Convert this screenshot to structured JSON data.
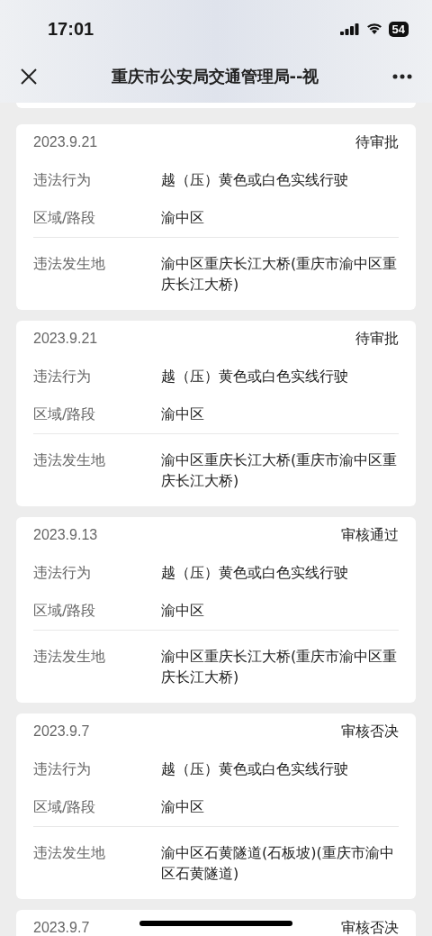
{
  "status_bar": {
    "time": "17:01",
    "battery": "54"
  },
  "nav_bar": {
    "title": "重庆市公安局交通管理局--视"
  },
  "records": [
    {
      "date": "2023.9.21",
      "status": "待审批",
      "rows": [
        {
          "label": "违法行为",
          "value": "越（压）黄色或白色实线行驶"
        },
        {
          "label": "区域/路段",
          "value": "渝中区"
        },
        {
          "label": "违法发生地",
          "value": "渝中区重庆长江大桥(重庆市渝中区重庆长江大桥)"
        }
      ]
    },
    {
      "date": "2023.9.21",
      "status": "待审批",
      "rows": [
        {
          "label": "违法行为",
          "value": "越（压）黄色或白色实线行驶"
        },
        {
          "label": "区域/路段",
          "value": "渝中区"
        },
        {
          "label": "违法发生地",
          "value": "渝中区重庆长江大桥(重庆市渝中区重庆长江大桥)"
        }
      ]
    },
    {
      "date": "2023.9.13",
      "status": "审核通过",
      "rows": [
        {
          "label": "违法行为",
          "value": "越（压）黄色或白色实线行驶"
        },
        {
          "label": "区域/路段",
          "value": "渝中区"
        },
        {
          "label": "违法发生地",
          "value": "渝中区重庆长江大桥(重庆市渝中区重庆长江大桥)"
        }
      ]
    },
    {
      "date": "2023.9.7",
      "status": "审核否决",
      "rows": [
        {
          "label": "违法行为",
          "value": "越（压）黄色或白色实线行驶"
        },
        {
          "label": "区域/路段",
          "value": "渝中区"
        },
        {
          "label": "违法发生地",
          "value": "渝中区石黄隧道(石板坡)(重庆市渝中区石黄隧道)"
        }
      ]
    },
    {
      "date": "2023.9.7",
      "status": "审核否决"
    }
  ]
}
